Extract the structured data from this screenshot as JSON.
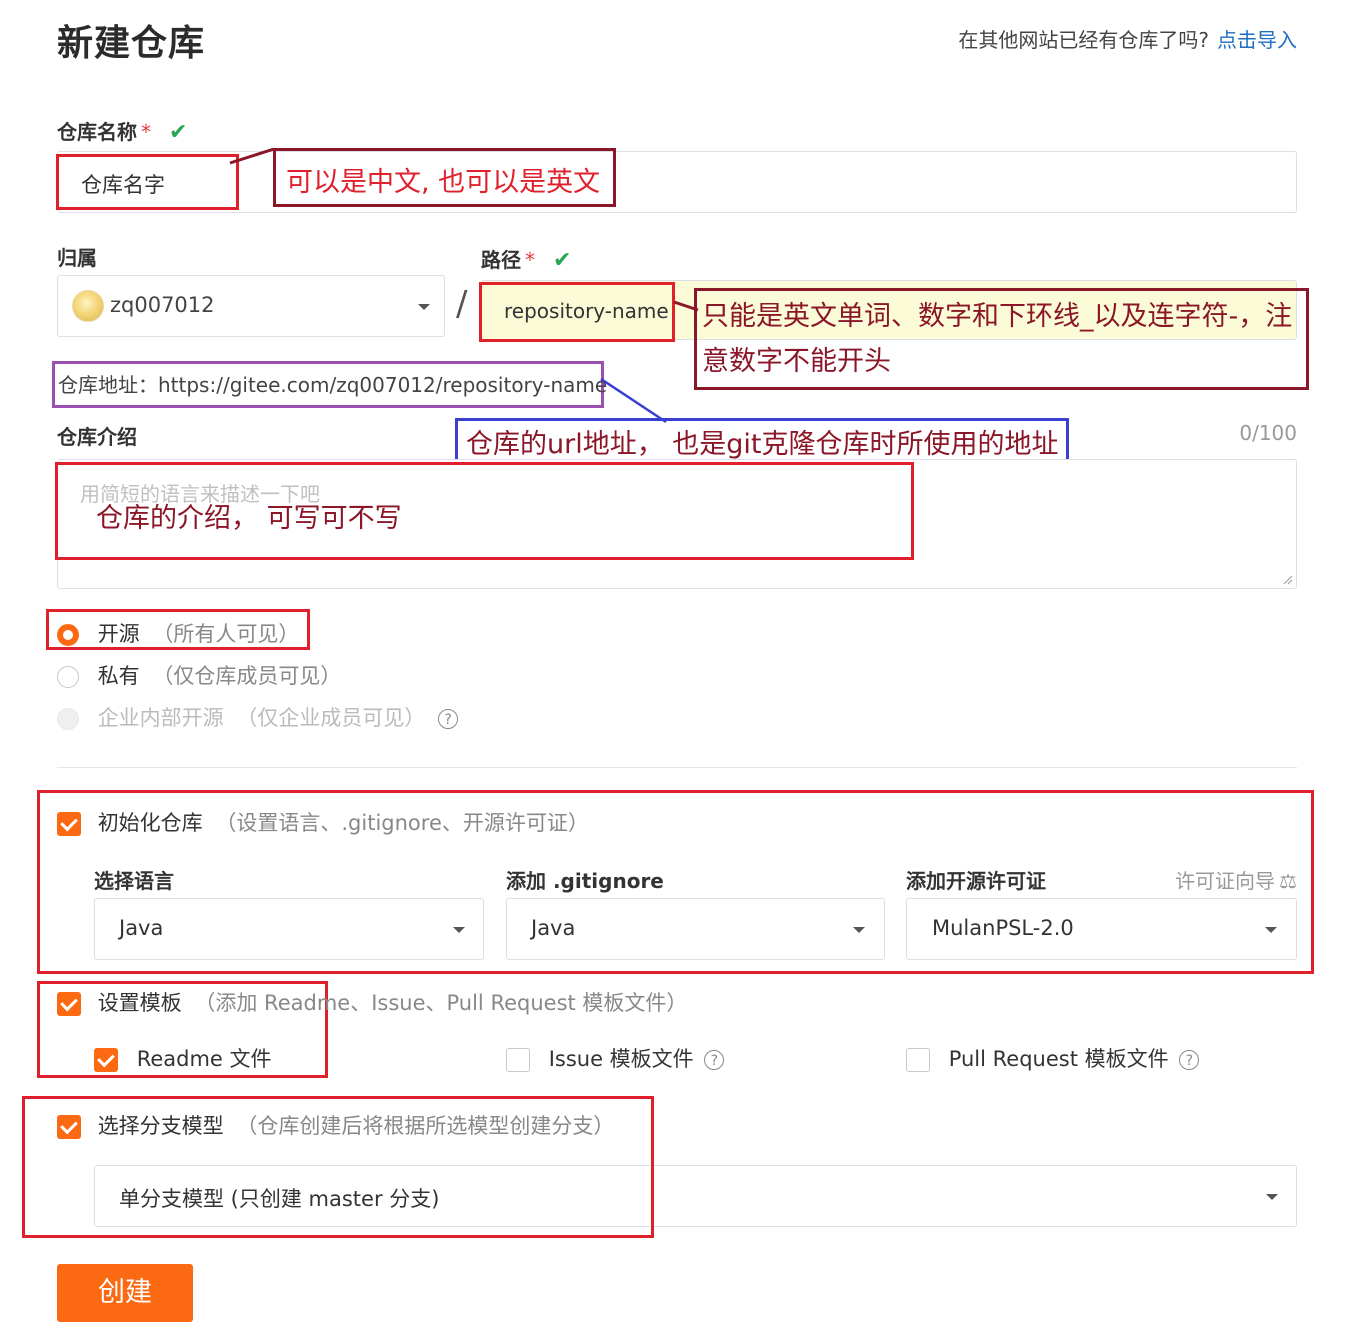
{
  "page": {
    "title": "新建仓库",
    "import_question": "在其他网站已经有仓库了吗?",
    "import_link": "点击导入"
  },
  "repo_name": {
    "label": "仓库名称",
    "required_mark": "*",
    "value": "仓库名字",
    "note": "可以是中文, 也可以是英文"
  },
  "owner": {
    "label": "归属",
    "value": "zq007012",
    "separator": "/"
  },
  "path": {
    "label": "路径",
    "required_mark": "*",
    "value": "repository-name",
    "note_line1": "只能是英文单词、数字和下环线_以及连字符-，注",
    "note_line2": "意数字不能开头"
  },
  "repo_url": {
    "text": "仓库地址：https://gitee.com/zq007012/repository-name",
    "note": "仓库的url地址，  也是git克隆仓库时所使用的地址"
  },
  "description": {
    "label": "仓库介绍",
    "counter": "0/100",
    "placeholder": "用简短的语言来描述一下吧",
    "note": "仓库的介绍，   可写可不写"
  },
  "visibility": {
    "options": [
      {
        "label": "开源",
        "hint": "（所有人可见）",
        "state": "selected"
      },
      {
        "label": "私有",
        "hint": "（仅仓库成员可见）",
        "state": "unselected"
      },
      {
        "label": "企业内部开源",
        "hint": "（仅企业成员可见）",
        "state": "disabled"
      }
    ]
  },
  "init_repo": {
    "label": "初始化仓库",
    "hint": "（设置语言、.gitignore、开源许可证）",
    "checked": true,
    "language_label": "选择语言",
    "language_value": "Java",
    "gitignore_label": "添加 .gitignore",
    "gitignore_value": "Java",
    "license_label": "添加开源许可证",
    "license_wizard": "许可证向导",
    "license_value": "MulanPSL-2.0"
  },
  "templates": {
    "label": "设置模板",
    "hint": "（添加 Readme、Issue、Pull Request 模板文件）",
    "checked": true,
    "readme_label": "Readme 文件",
    "issue_label": "Issue 模板文件",
    "pr_label": "Pull Request 模板文件"
  },
  "branch_model": {
    "label": "选择分支模型",
    "hint": "（仓库创建后将根据所选模型创建分支）",
    "checked": true,
    "value": "单分支模型 (只创建 master 分支)"
  },
  "create_button": "创建",
  "colors": {
    "accent": "#fb6a12",
    "annotation_red": "#e0202c",
    "annotation_darkred": "#8b1628",
    "annotation_purple": "#9b4fb0",
    "annotation_blue": "#3a3fd0",
    "link": "#1e6fbf",
    "valid": "#2aa44f"
  }
}
